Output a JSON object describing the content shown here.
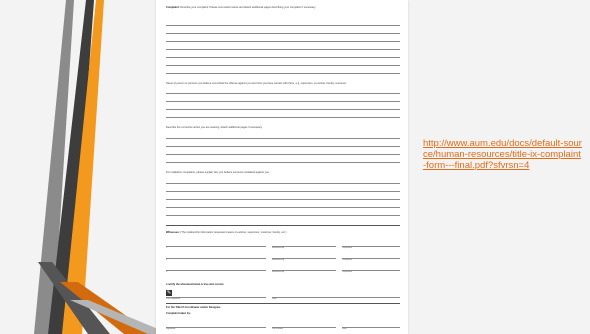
{
  "document": {
    "complaint_heading": "Complaint:",
    "complaint_text": "Describe your complaint. Please summarize below and attach additional pages describing your complaint if necessary.",
    "persons_text": "Name of person or persons you believe committed the offense against you and how you have contact with them, e.g. supervisor, co-worker, faculty, customer:",
    "corrective_text": "Describe the corrective action you are seeking. Attach additional pages if necessary.",
    "retaliation_text": "For retaliation complaints, please explain why you believe someone retaliated against you:",
    "witnesses_heading": "Witnesses:",
    "witnesses_text": "(The relationship information requested means co-worker, supervisor, customer, faculty, etc.)",
    "witness_rows": [
      {
        "num": "1.",
        "relationship": "Relationship",
        "telephone": "Telephone"
      },
      {
        "num": "2.",
        "relationship": "Relationship",
        "telephone": "Telephone"
      },
      {
        "num": "3.",
        "relationship": "Relationship",
        "telephone": "Telephone"
      }
    ],
    "certify_text": "I certify the aforementioned is true and correct.",
    "signature_label": "Your Signature",
    "date_label": "Date",
    "office_heading": "For the Title IX Coordinator and/or Designee",
    "received_text": "Complaint taken by:",
    "bottom_labels": {
      "signature": "Signature",
      "print_name": "Print Name",
      "date": "Date"
    }
  },
  "link": {
    "text": "http://www.aum.edu/docs/default-source/human-resources/title-ix-complaint-form---final.pdf?sfvrsn=4"
  },
  "colors": {
    "accent": "#e46c17",
    "deco_orange": "#f39a1e",
    "deco_dark": "#3d3d3d",
    "deco_gray": "#8b8b8b",
    "background": "#f3f3f3"
  }
}
